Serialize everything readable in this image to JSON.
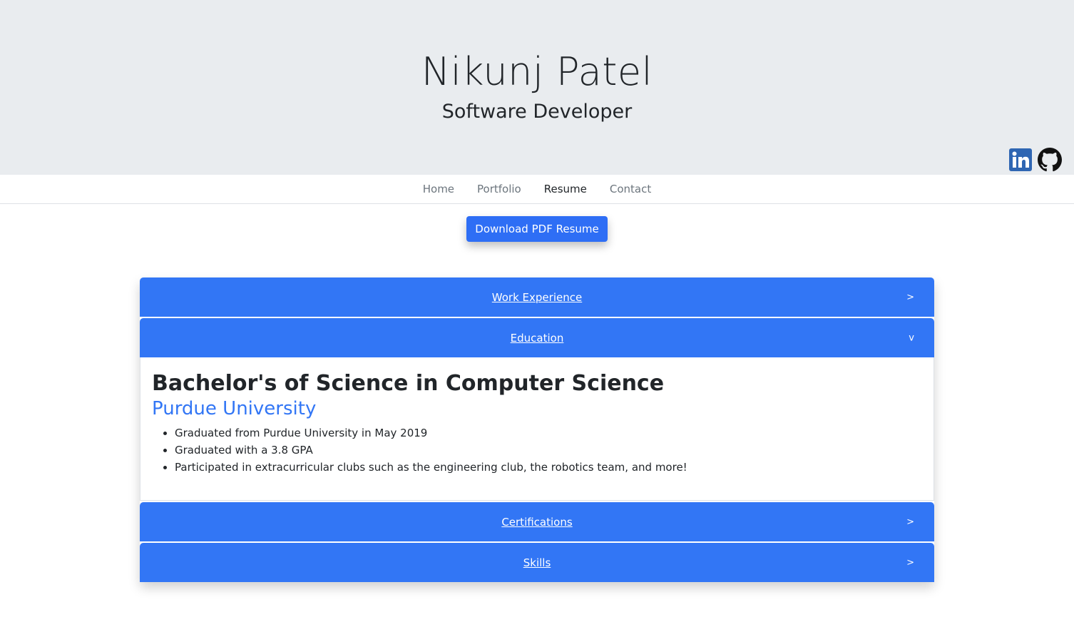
{
  "header": {
    "name": "Nikunj Patel",
    "title": "Software Developer",
    "social": [
      {
        "icon": "linkedin-icon",
        "color": "#2f66b3"
      },
      {
        "icon": "github-icon",
        "color": "#111111"
      }
    ]
  },
  "nav": {
    "items": [
      {
        "label": "Home",
        "active": false
      },
      {
        "label": "Portfolio",
        "active": false
      },
      {
        "label": "Resume",
        "active": true
      },
      {
        "label": "Contact",
        "active": false
      }
    ]
  },
  "download": {
    "label": "Download PDF Resume"
  },
  "accordion": {
    "accent": "#3276f5",
    "sections": [
      {
        "label": "Work Experience",
        "chevron": ">",
        "expanded": false
      },
      {
        "label": "Education",
        "chevron": "v",
        "expanded": true
      },
      {
        "label": "Certifications",
        "chevron": ">",
        "expanded": false
      },
      {
        "label": "Skills",
        "chevron": ">",
        "expanded": false
      }
    ],
    "education": {
      "degree": "Bachelor's of Science in Computer Science",
      "school": "Purdue University",
      "bullets": [
        "Graduated from Purdue University in May 2019",
        "Graduated with a 3.8 GPA",
        "Participated in extracurricular clubs such as the engineering club, the robotics team, and more!"
      ]
    }
  }
}
